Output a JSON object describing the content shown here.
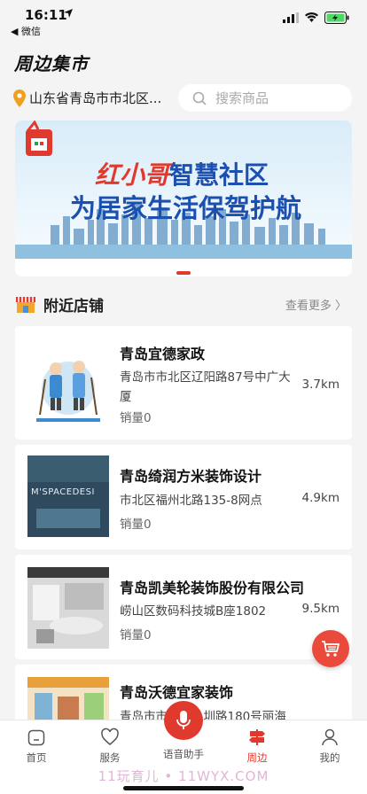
{
  "status_bar": {
    "time": "16:11",
    "back_label": "◀ 微信"
  },
  "header": {
    "title": "周边集市"
  },
  "location": {
    "text": "山东省青岛市市北区..."
  },
  "search": {
    "placeholder": "搜索商品"
  },
  "banner": {
    "brand": "红小哥",
    "headline1": "智慧社区",
    "headline2": "为居家生活保驾护航"
  },
  "section": {
    "title": "附近店铺",
    "more_label": "查看更多 〉"
  },
  "shops": [
    {
      "name": "青岛宜德家政",
      "address": "青岛市市北区辽阳路87号中广大厦",
      "distance": "3.7km",
      "sales": "销量0"
    },
    {
      "name": "青岛绮润方米装饰设计",
      "address": "市北区福州北路135-8网点",
      "distance": "4.9km",
      "sales": "销量0",
      "thumb_text": "M'SPACEDESI"
    },
    {
      "name": "青岛凯美轮装饰股份有限公司",
      "address": "崂山区数码科技城B座1802",
      "distance": "9.5km",
      "sales": "销量0"
    },
    {
      "name": "青岛沃德宜家装饰",
      "address": "青岛市市北区…圳路180号丽海",
      "distance": "",
      "sales": ""
    }
  ],
  "tabs": [
    {
      "label": "首页"
    },
    {
      "label": "服务"
    },
    {
      "label": "语音助手"
    },
    {
      "label": "周边"
    },
    {
      "label": "我的"
    }
  ],
  "watermark": "11玩育儿 • 11WYX.COM",
  "colors": {
    "accent": "#e03a2e",
    "background": "#f4f4f4"
  },
  "icons": [
    "location-arrow-icon",
    "signal-icon",
    "wifi-icon",
    "battery-icon",
    "pin-icon",
    "search-icon",
    "shop-icon",
    "cart-icon",
    "home-icon",
    "heart-icon",
    "mic-icon",
    "signpost-icon",
    "user-icon"
  ]
}
